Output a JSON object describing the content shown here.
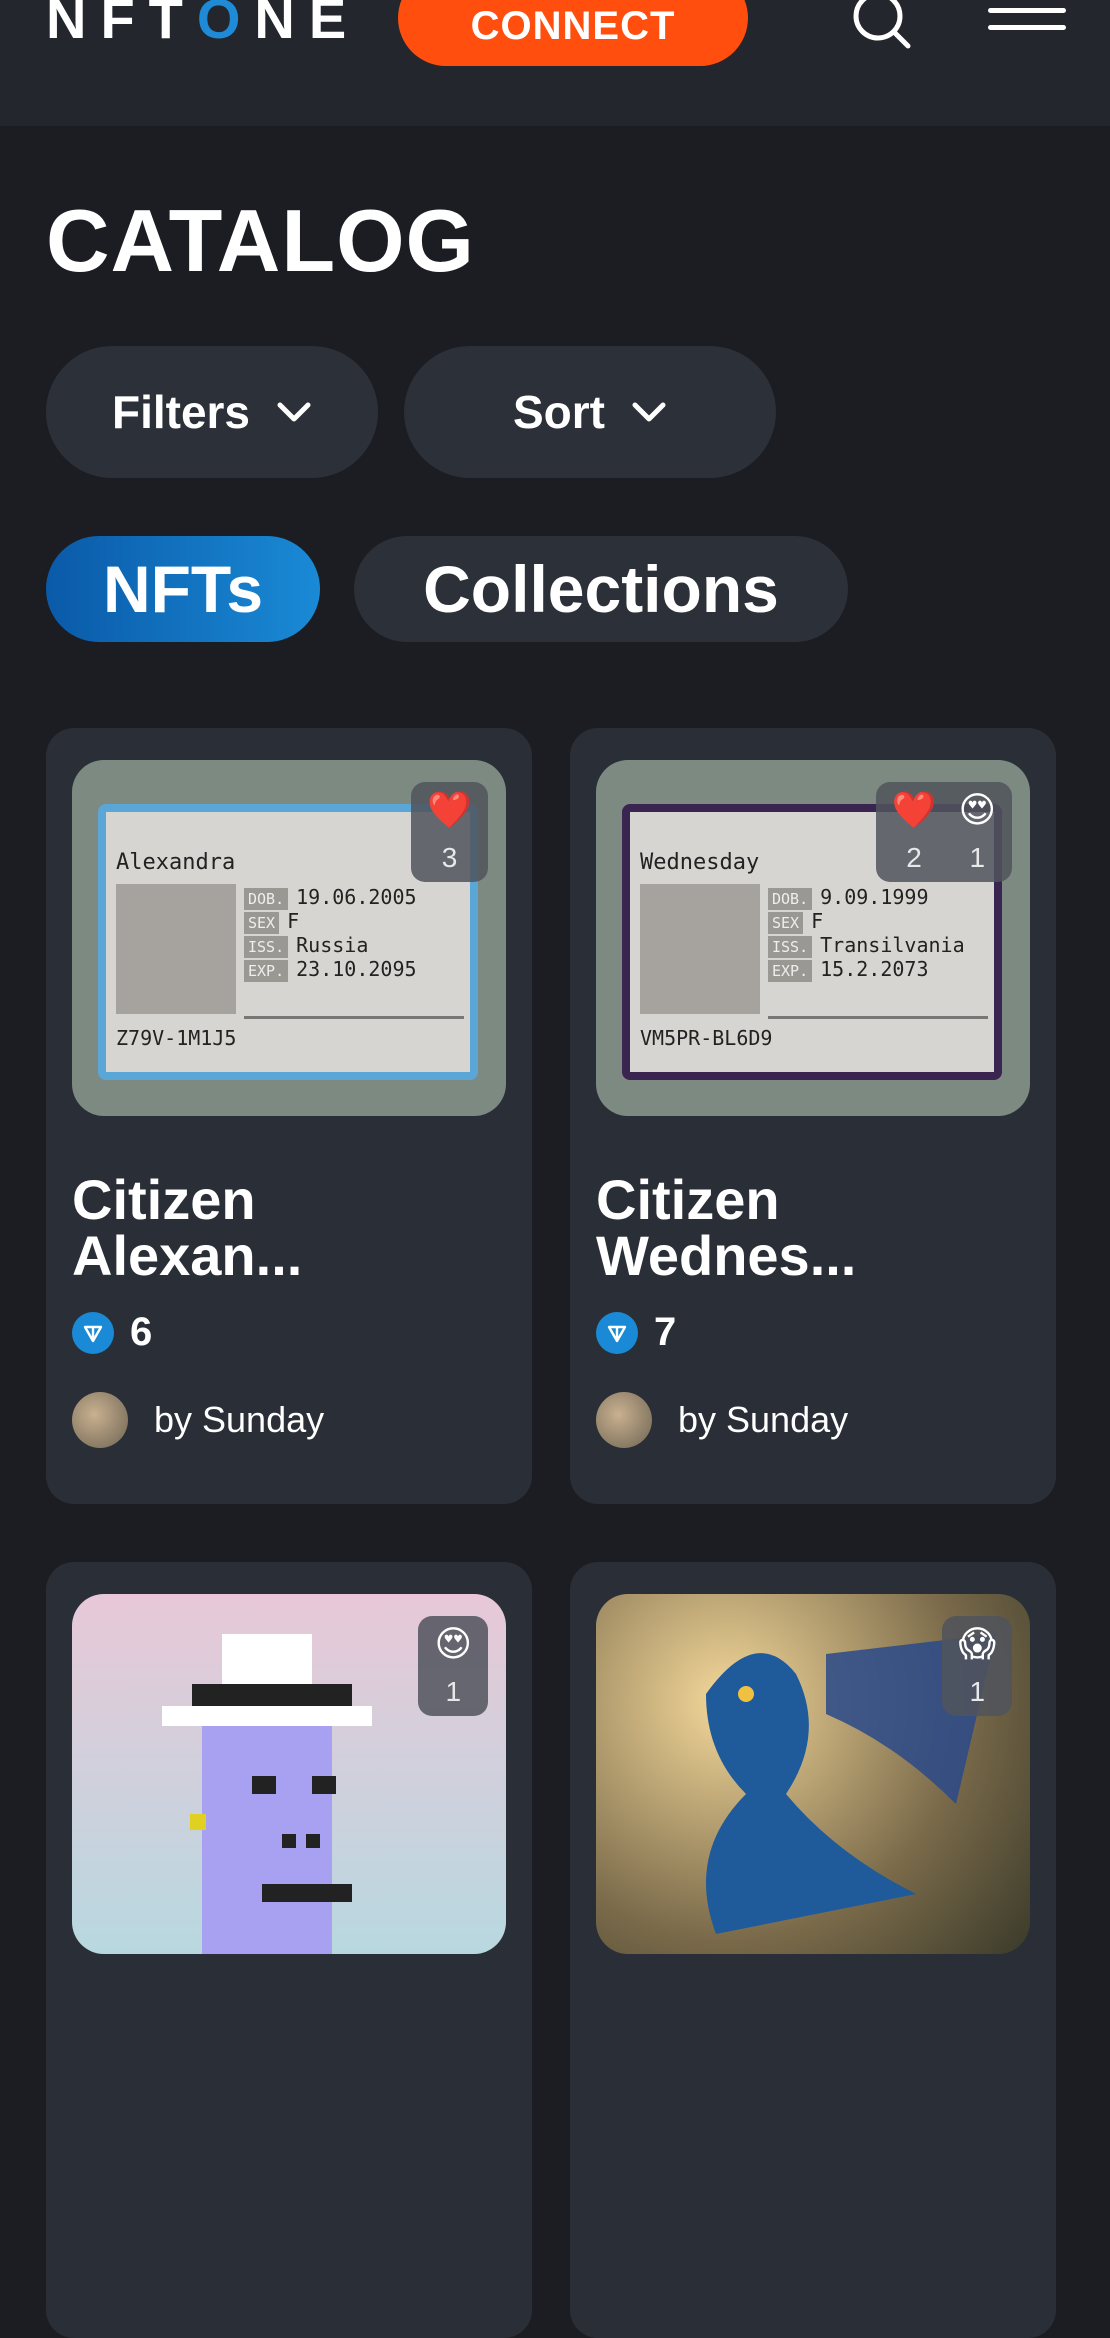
{
  "header": {
    "logo_left": "NFT",
    "logo_o": "O",
    "logo_right": "NE",
    "connect_label": "CONNECT"
  },
  "page": {
    "title": "CATALOG"
  },
  "controls": {
    "filters_label": "Filters",
    "sort_label": "Sort"
  },
  "tabs": [
    {
      "label": "NFTs",
      "active": true
    },
    {
      "label": "Collections",
      "active": false
    }
  ],
  "colors": {
    "accent": "#ff4e0e",
    "active_tab": "#1a8ad6",
    "background": "#1b1d22",
    "card": "#2a2e36"
  },
  "cards": [
    {
      "name_line1": "Citizen",
      "name_line2": "Alexan...",
      "price": "6",
      "author": "by Sunday",
      "reactions": [
        {
          "emoji": "❤️",
          "count": "3"
        }
      ],
      "id_card": {
        "name": "Alexandra",
        "dob": "19.06.2005",
        "sex": "F",
        "iss": "Russia",
        "exp": "23.10.2095",
        "code": "Z79V-1M1J5"
      }
    },
    {
      "name_line1": "Citizen",
      "name_line2": "Wednes...",
      "price": "7",
      "author": "by Sunday",
      "reactions": [
        {
          "emoji": "❤️",
          "count": "2"
        },
        {
          "emoji": "😍",
          "count": "1"
        }
      ],
      "id_card": {
        "name": "Wednesday",
        "dob": "9.09.1999",
        "sex": "F",
        "iss": "Transilvania",
        "exp": "15.2.2073",
        "code": "VM5PR-BL6D9"
      }
    },
    {
      "reactions": [
        {
          "emoji": "😍",
          "count": "1"
        }
      ]
    },
    {
      "reactions": [
        {
          "emoji": "😱",
          "count": "1"
        }
      ]
    }
  ],
  "id_labels": {
    "dob": "DOB.",
    "sex": "SEX",
    "iss": "ISS.",
    "exp": "EXP."
  },
  "icons": [
    "search-icon",
    "menu-icon",
    "chevron-down-icon",
    "ton-icon",
    "heart-icon"
  ]
}
